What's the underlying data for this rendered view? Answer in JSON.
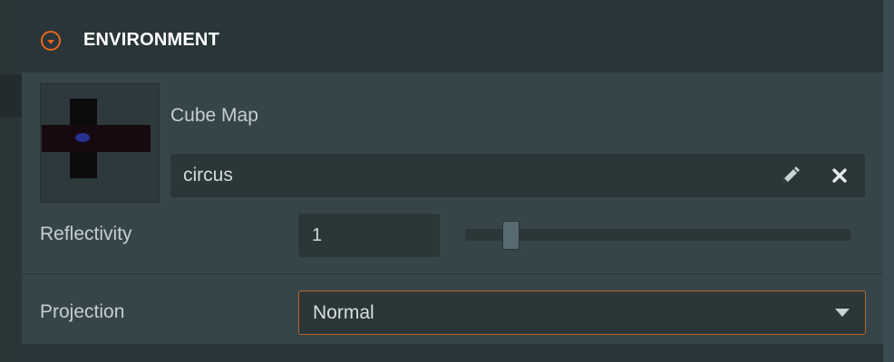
{
  "section": {
    "title": "ENVIRONMENT",
    "toggle_icon": "chevron-down-circle-icon"
  },
  "cube_map": {
    "label": "Cube Map",
    "value": "circus",
    "edit_icon": "pencil-icon",
    "clear_icon": "close-icon"
  },
  "reflectivity": {
    "label": "Reflectivity",
    "value": "1",
    "slider_fraction": 0.1
  },
  "projection": {
    "label": "Projection",
    "selected": "Normal",
    "dropdown_icon": "caret-down-icon"
  },
  "colors": {
    "accent": "#e5671c",
    "panel": "#364549",
    "field": "#2b3639"
  }
}
